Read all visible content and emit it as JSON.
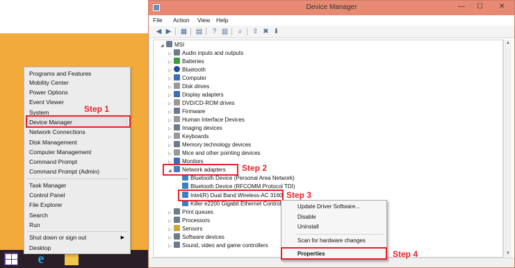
{
  "winx_menu": {
    "items": [
      "Programs and Features",
      "Mobility Center",
      "Power Options",
      "Event Viewer",
      "System",
      "Device Manager",
      "Network Connections",
      "Disk Management",
      "Computer Management",
      "Command Prompt",
      "Command Prompt (Admin)",
      "Task Manager",
      "Control Panel",
      "File Explorer",
      "Search",
      "Run",
      "Shut down or sign out",
      "Desktop"
    ]
  },
  "window": {
    "title": "Device Manager",
    "minimize": "—",
    "maximize": "☐",
    "close": "✕"
  },
  "menu": {
    "file": "File",
    "action": "Action",
    "view": "View",
    "help": "Help"
  },
  "tree": {
    "root": "MSI",
    "categories": [
      "Audio inputs and outputs",
      "Batteries",
      "Bluetooth",
      "Computer",
      "Disk drives",
      "Display adapters",
      "DVD/CD-ROM drives",
      "Firmware",
      "Human Interface Devices",
      "Imaging devices",
      "Keyboards",
      "Memory technology devices",
      "Mice and other pointing devices",
      "Monitors",
      "Network adapters"
    ],
    "network_children": [
      "Bluetooth Device (Personal Area Network)",
      "Bluetooth Device (RFCOMM Protocol TDI)",
      "Intel(R) Dual Band Wireless-AC 3160",
      "Killer e2200 Gigabit Ethernet Control"
    ],
    "after": [
      "Print queues",
      "Processors",
      "Sensors",
      "Software devices",
      "Sound, video and game controllers"
    ]
  },
  "context_menu": {
    "update": "Update Driver Software...",
    "disable": "Disable",
    "uninstall": "Uninstall",
    "scan": "Scan for hardware changes",
    "properties": "Properties"
  },
  "steps": {
    "s1": "Step 1",
    "s2": "Step 2",
    "s3": "Step 3",
    "s4": "Step 4"
  },
  "colors": {
    "annotation": "#e8202a",
    "titlebar": "#e88a73",
    "desktop": "#f2aa3b"
  }
}
